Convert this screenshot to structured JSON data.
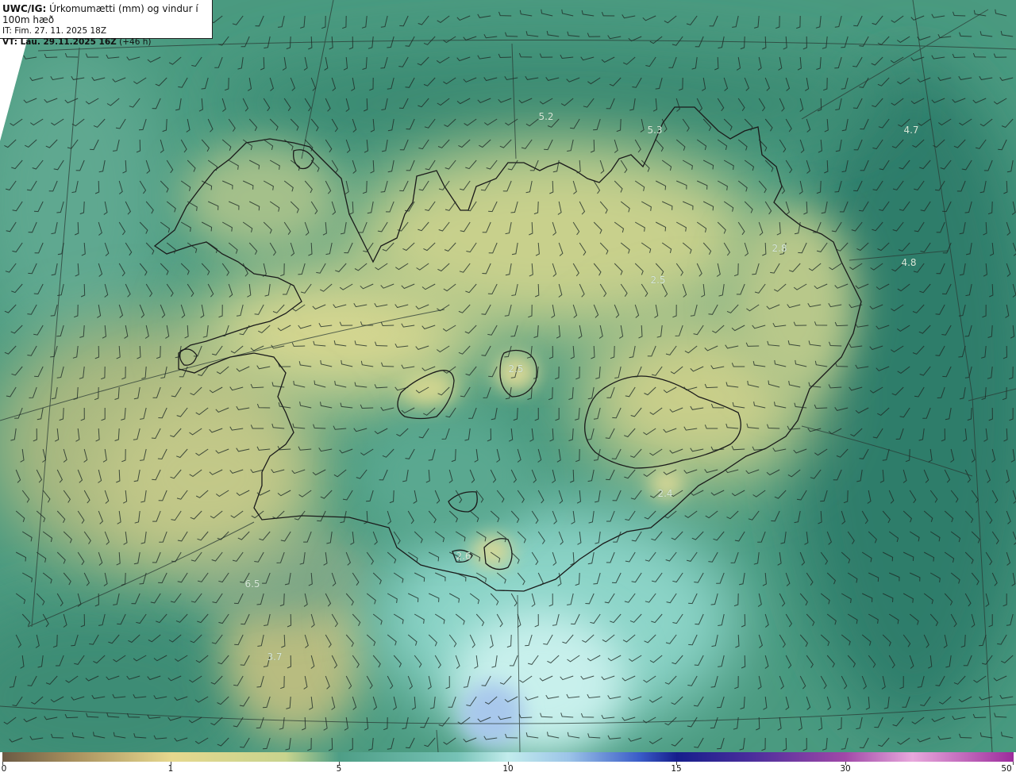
{
  "header": {
    "model": "UWC/IG:",
    "description": "Úrkomumætti (mm) og vindur í 100m hæð",
    "issue_time": "IT: Fim. 27. 11. 2025 18Z",
    "valid_prefix": "VT: Lau. 29.11.2025 16Z",
    "valid_suffix": "(+46 h)"
  },
  "map_labels": [
    {
      "id": "label-n1",
      "text": "5.2"
    },
    {
      "id": "label-n2",
      "text": "5.3"
    },
    {
      "id": "label-ne",
      "text": "4.7"
    },
    {
      "id": "label-e",
      "text": "4.8"
    },
    {
      "id": "label-e2",
      "text": "2.8"
    },
    {
      "id": "label-c1",
      "text": "2.5"
    },
    {
      "id": "label-c2",
      "text": "2.5"
    },
    {
      "id": "label-se",
      "text": "2.4"
    },
    {
      "id": "label-s",
      "text": "2.6"
    },
    {
      "id": "label-sw1",
      "text": "6.5"
    },
    {
      "id": "label-sw2",
      "text": "3.7"
    }
  ],
  "colorbar": {
    "ticks": [
      "0",
      "1",
      "5",
      "10",
      "15",
      "30",
      "50"
    ]
  },
  "colors": {
    "land_yellow": "#cfd48e",
    "sea_green": "#3c8a76",
    "sea_light": "#a8e0dc",
    "coast_line": "#1a1a1a"
  }
}
